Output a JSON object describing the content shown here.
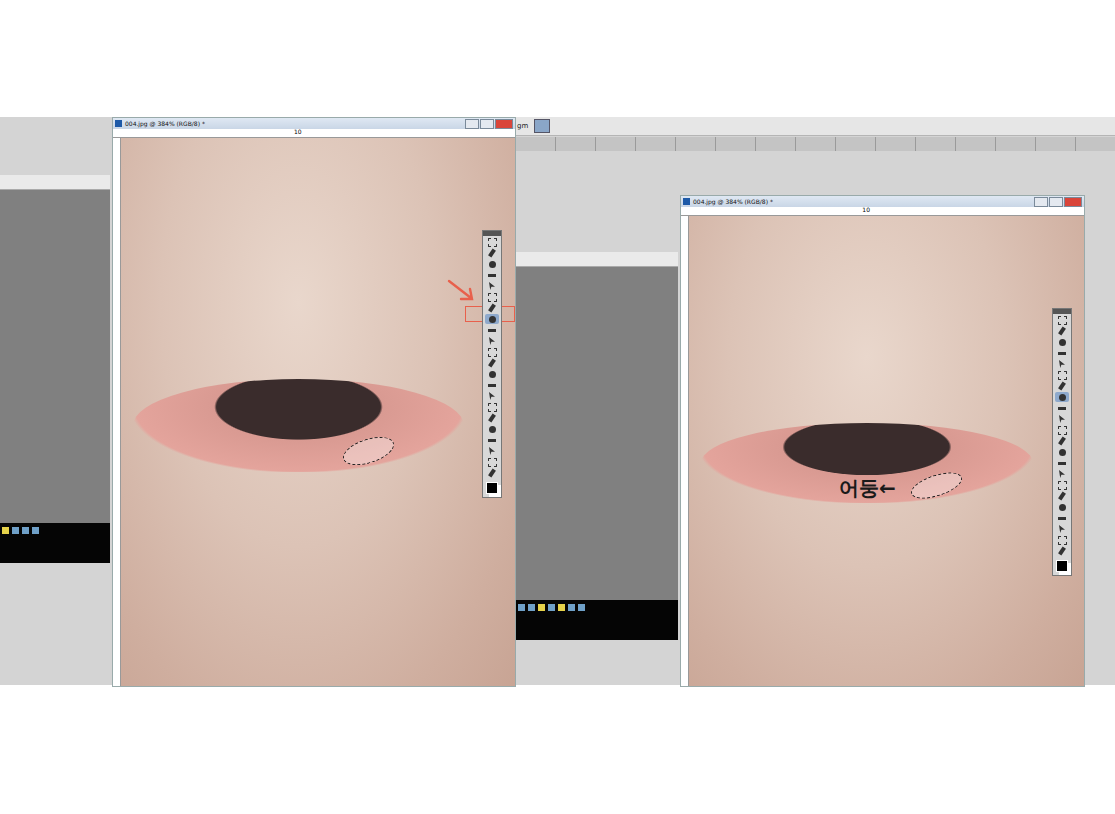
{
  "windows": [
    {
      "title": "004.jpg @ 384% (RGB/8) *",
      "ruler": "10",
      "selection": true,
      "pointer": true,
      "toolbox": {
        "tools": [
          {
            "selected": false
          },
          {
            "selected": false
          },
          {
            "selected": false
          },
          {
            "selected": false
          },
          {
            "selected": false
          },
          {
            "selected": false
          },
          {
            "selected": false
          },
          {
            "selected": true
          },
          {
            "selected": false
          },
          {
            "selected": false
          },
          {
            "selected": false
          },
          {
            "selected": false
          },
          {
            "selected": false
          },
          {
            "selected": false
          },
          {
            "selected": false
          },
          {
            "selected": false
          },
          {
            "selected": false
          },
          {
            "selected": false
          },
          {
            "selected": false
          },
          {
            "selected": false
          },
          {
            "selected": false
          },
          {
            "selected": false
          }
        ]
      }
    },
    {
      "title": "004.jpg @ 384% (RGB/8) *",
      "ruler": "10",
      "selection": true,
      "pointer": false,
      "annotation": "어둥←",
      "toolbox": {
        "tools": [
          {
            "selected": false
          },
          {
            "selected": false
          },
          {
            "selected": false
          },
          {
            "selected": false
          },
          {
            "selected": false
          },
          {
            "selected": false
          },
          {
            "selected": false
          },
          {
            "selected": true
          },
          {
            "selected": false
          },
          {
            "selected": false
          },
          {
            "selected": false
          },
          {
            "selected": false
          },
          {
            "selected": false
          },
          {
            "selected": false
          },
          {
            "selected": false
          },
          {
            "selected": false
          },
          {
            "selected": false
          },
          {
            "selected": false
          },
          {
            "selected": false
          },
          {
            "selected": false
          },
          {
            "selected": false
          },
          {
            "selected": false
          }
        ]
      }
    }
  ],
  "panel": {
    "label": "gm"
  }
}
